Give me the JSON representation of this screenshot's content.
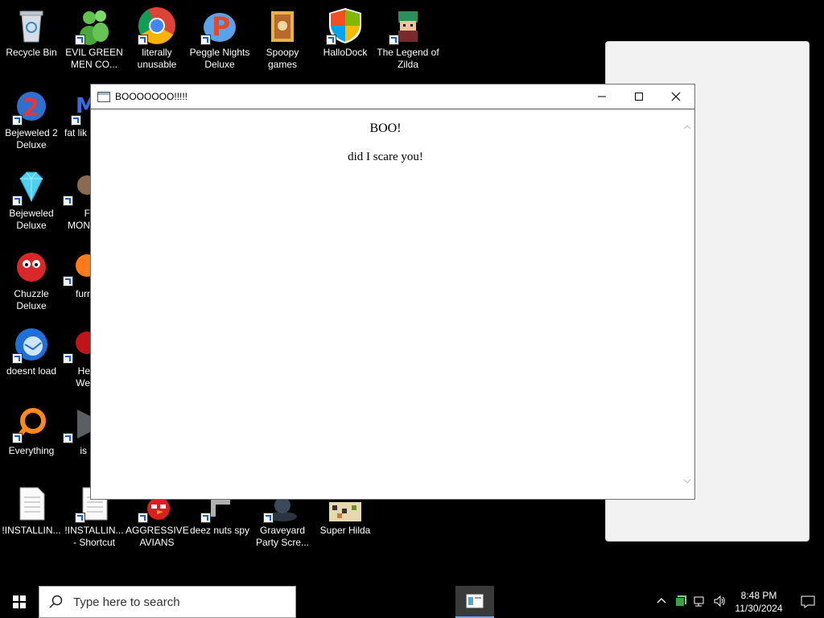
{
  "desktop": {
    "icons": [
      {
        "label": "Recycle Bin"
      },
      {
        "label": "EVIL GREEN MEN CO..."
      },
      {
        "label": "literally unusable"
      },
      {
        "label": "Peggle Nights Deluxe"
      },
      {
        "label": "Spoopy games"
      },
      {
        "label": "HalloDock"
      },
      {
        "label": "The Legend of Zilda"
      },
      {
        "label": "Bejeweled 2 Deluxe"
      },
      {
        "label": "fat lik"
      },
      {
        "label": "Bejeweled Deluxe"
      },
      {
        "label": "F MON"
      },
      {
        "label": "Chuzzle Deluxe"
      },
      {
        "label": "furr"
      },
      {
        "label": "doesnt load"
      },
      {
        "label": "He We"
      },
      {
        "label": "Everything"
      },
      {
        "label": "is"
      },
      {
        "label": "!INSTALLIN..."
      },
      {
        "label": "!INSTALLIN... - Shortcut"
      },
      {
        "label": "AGGRESSIVE AVIANS"
      },
      {
        "label": "deez nuts spy"
      },
      {
        "label": "Graveyard Party Scre..."
      },
      {
        "label": "Super Hilda"
      }
    ]
  },
  "window": {
    "title": "BOOOOOOO!!!!!",
    "heading": "BOO!",
    "message": "did I scare you!"
  },
  "taskbar": {
    "search_placeholder": "Type here to search",
    "time": "8:48 PM",
    "date": "11/30/2024"
  },
  "colors": {
    "taskbar_bg": "#000000",
    "accent": "#79a6e6"
  }
}
